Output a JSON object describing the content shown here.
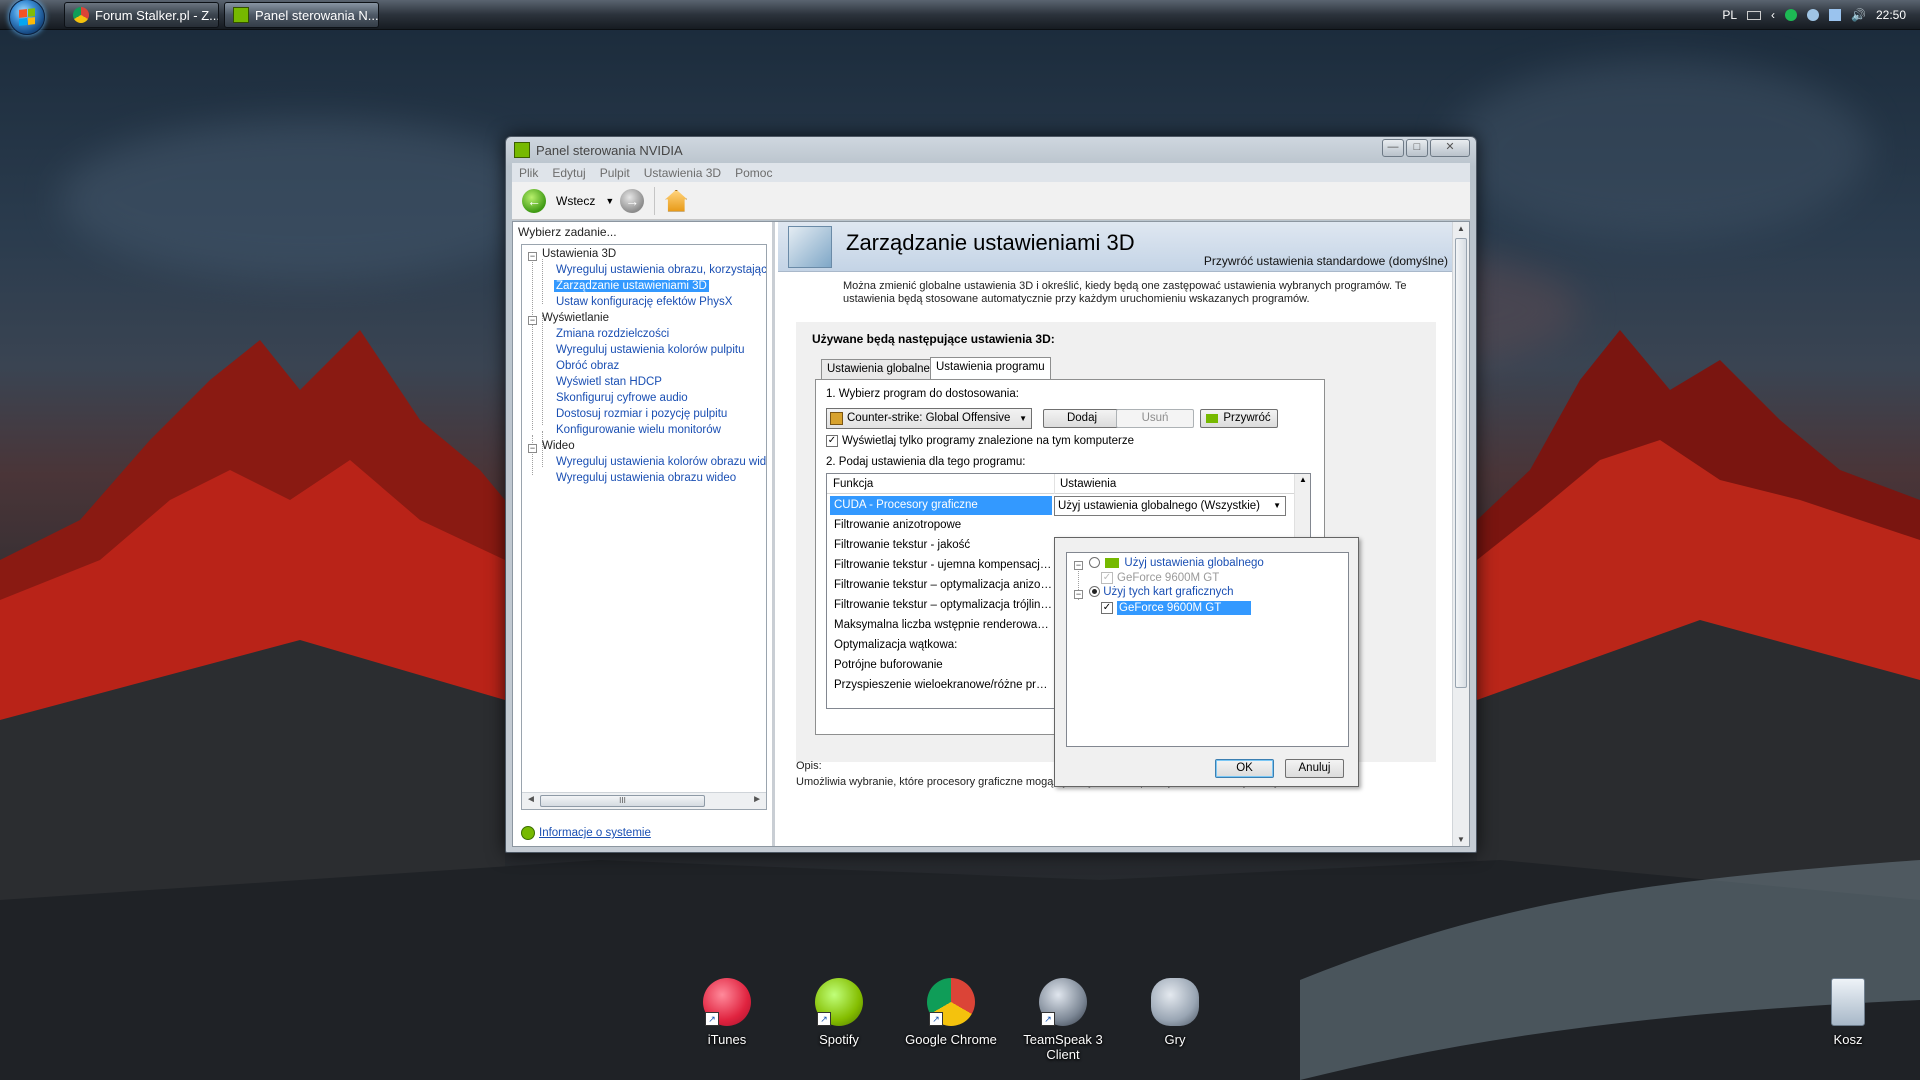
{
  "taskbar": {
    "buttons": [
      {
        "label": "Forum Stalker.pl - Z..."
      },
      {
        "label": "Panel sterowania N..."
      }
    ],
    "tray": {
      "lang": "PL",
      "clock": "22:50"
    }
  },
  "desktop": {
    "icons": [
      {
        "label": "iTunes"
      },
      {
        "label": "Spotify"
      },
      {
        "label": "Google Chrome"
      },
      {
        "label": "TeamSpeak 3 Client"
      },
      {
        "label": "Gry"
      },
      {
        "label": "Kosz"
      }
    ]
  },
  "window": {
    "title": "Panel sterowania NVIDIA",
    "caption_buttons": {
      "minimize": "—",
      "maximize": "□",
      "close": "✕"
    },
    "menu": [
      "Plik",
      "Edytuj",
      "Pulpit",
      "Ustawienia 3D",
      "Pomoc"
    ],
    "toolbar": {
      "back_label": "Wstecz"
    },
    "left": {
      "header": "Wybierz zadanie...",
      "tree": [
        {
          "label": "Ustawienia 3D",
          "kind": "category"
        },
        {
          "label": "Wyreguluj ustawienia obrazu, korzystając z podglądu",
          "kind": "link"
        },
        {
          "label": "Zarządzanie ustawieniami 3D",
          "kind": "selected"
        },
        {
          "label": "Ustaw konfigurację efektów PhysX",
          "kind": "link"
        },
        {
          "label": "Wyświetlanie",
          "kind": "category"
        },
        {
          "label": "Zmiana rozdzielczości",
          "kind": "link"
        },
        {
          "label": "Wyreguluj ustawienia kolorów pulpitu",
          "kind": "link"
        },
        {
          "label": "Obróć obraz",
          "kind": "link"
        },
        {
          "label": "Wyświetl stan HDCP",
          "kind": "link"
        },
        {
          "label": "Skonfiguruj cyfrowe audio",
          "kind": "link"
        },
        {
          "label": "Dostosuj rozmiar i pozycję pulpitu",
          "kind": "link"
        },
        {
          "label": "Konfigurowanie wielu monitorów",
          "kind": "link"
        },
        {
          "label": "Wideo",
          "kind": "category"
        },
        {
          "label": "Wyreguluj ustawienia kolorów obrazu wideo",
          "kind": "link"
        },
        {
          "label": "Wyreguluj ustawienia obrazu wideo",
          "kind": "link"
        }
      ],
      "scroll_label": "III",
      "info_link": "Informacje o systemie"
    },
    "right": {
      "title": "Zarządzanie ustawieniami 3D",
      "restore_link": "Przywróć ustawienia standardowe (domyślne)",
      "description": "Można zmienić globalne ustawienia 3D i określić, kiedy będą one zastępować ustawienia wybranych programów. Te ustawienia będą stosowane automatycznie przy każdym uruchomieniu wskazanych programów.",
      "group_title": "Używane będą następujące ustawienia 3D:",
      "tabs": [
        "Ustawienia globalne",
        "Ustawienia programu"
      ],
      "step1": "1. Wybierz program do dostosowania:",
      "program": "Counter-strike: Global Offensive",
      "buttons": {
        "add": "Dodaj",
        "remove": "Usuń",
        "restore": "Przywróć"
      },
      "only_installed": "Wyświetlaj tylko programy znalezione na tym komputerze",
      "step2": "2. Podaj ustawienia dla tego programu:",
      "columns": [
        "Funkcja",
        "Ustawienia"
      ],
      "rows": [
        "CUDA - Procesory graficzne",
        "Filtrowanie anizotropowe",
        "Filtrowanie tekstur - jakość",
        "Filtrowanie tekstur - ujemna kompensacja ...",
        "Filtrowanie tekstur – optymalizacja anizotr...",
        "Filtrowanie tekstur – optymalizacja trójlini...",
        "Maksymalna liczba wstępnie renderowany...",
        "Optymalizacja wątkowa:",
        "Potrójne buforowanie",
        "Przyspieszenie wieloekranowe/różne proc..."
      ],
      "selected_value": "Użyj ustawienia globalnego (Wszystkie)",
      "opis_label": "Opis:",
      "opis_text": "Umożliwia wybranie, które procesory graficzne mogą być używane w aplikacjach CUDA, w tym PhysX."
    },
    "popup": {
      "option_global": "Użyj ustawienia globalnego",
      "global_gpu": "GeForce 9600M GT",
      "option_these": "Użyj tych kart graficznych",
      "these_gpu": "GeForce 9600M GT",
      "ok": "OK",
      "cancel": "Anuluj"
    }
  },
  "colors": {
    "nvidia_green": "#76b900",
    "selection_blue": "#3399ff",
    "link_blue": "#1a4fb3"
  }
}
